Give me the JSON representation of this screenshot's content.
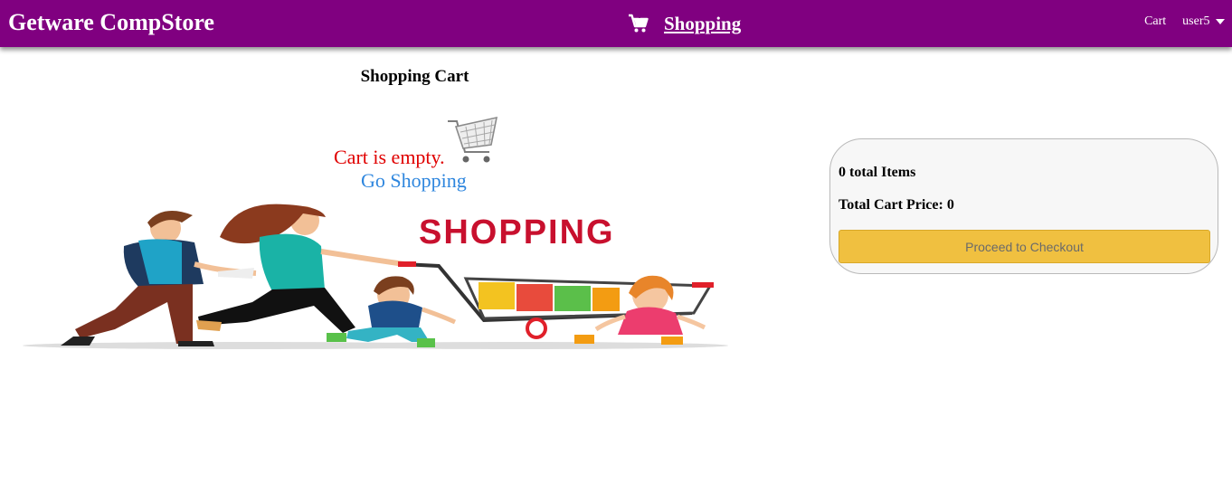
{
  "header": {
    "brand": "Getware CompStore",
    "nav_label": "Shopping",
    "cart_link": "Cart",
    "user_menu": "user5",
    "bg_color": "#800080",
    "icons": [
      "cart-icon",
      "caret-down-icon"
    ]
  },
  "main": {
    "title": "Shopping Cart",
    "empty_message": "Cart is empty.",
    "go_shopping": "Go Shopping",
    "banner_text": "SHOPPING"
  },
  "summary": {
    "items_text": "0 total Items",
    "price_text": "Total Cart Price: 0",
    "checkout_label": "Proceed to Checkout",
    "checkout_color": "#f0c040"
  }
}
